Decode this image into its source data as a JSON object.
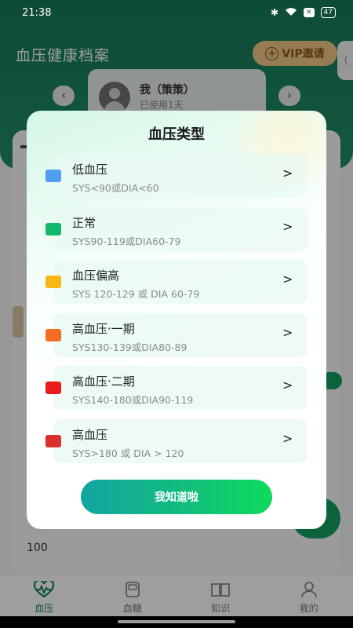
{
  "status_bar": {
    "time": "21:38",
    "battery": "47"
  },
  "header": {
    "title": "血压健康档案",
    "vip_label": "VIP邀请"
  },
  "profile": {
    "name": "我（策策）",
    "usage": "已使用1天"
  },
  "background": {
    "value": "100"
  },
  "modal": {
    "title": "血压类型",
    "items": [
      {
        "name": "低血压",
        "range": "SYS<90或DIA<60",
        "color": "#4f9ef2"
      },
      {
        "name": "正常",
        "range": "SYS90-119或DIA60-79",
        "color": "#13b86a"
      },
      {
        "name": "血压偏高",
        "range": "SYS 120-129 或 DIA 60-79",
        "color": "#f7b717"
      },
      {
        "name": "高血压·一期",
        "range": "SYS130-139或DIA80-89",
        "color": "#f36d22"
      },
      {
        "name": "高血压·二期",
        "range": "SYS140-180或DIA90-119",
        "color": "#ea1b1b"
      },
      {
        "name": "高血压",
        "range": "SYS>180 或 DIA > 120",
        "color": "#d8302f"
      }
    ],
    "confirm_label": "我知道啦"
  },
  "tabs": [
    {
      "label": "血压",
      "icon": "heart-pulse-icon",
      "active": true
    },
    {
      "label": "血糖",
      "icon": "glucose-meter-icon",
      "active": false
    },
    {
      "label": "知识",
      "icon": "book-icon",
      "active": false
    },
    {
      "label": "我的",
      "icon": "person-icon",
      "active": false
    }
  ],
  "colors": {
    "brand_green": "#177a58",
    "accent_green": "#12c07a",
    "vip_gold": "#f3c989"
  }
}
